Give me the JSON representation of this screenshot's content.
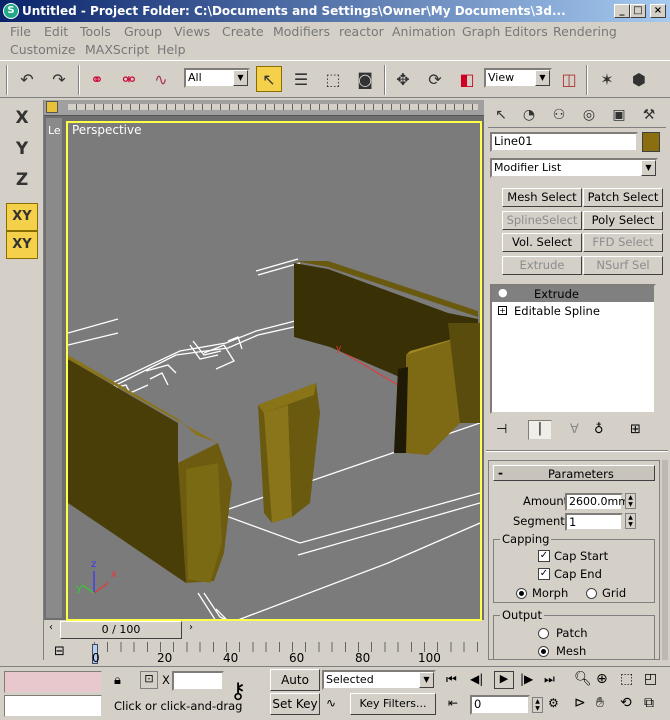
{
  "window": {
    "title": "Untitled     - Project Folder: C:\\Documents and Settings\\Owner\\My Documents\\3d...",
    "app_icon": "3ds-max-logo-icon",
    "controls": [
      "_",
      "□",
      "×"
    ]
  },
  "menubar": {
    "row1": [
      "File",
      "Edit",
      "Tools",
      "Group",
      "Views",
      "Create",
      "Modifiers",
      "reactor",
      "Animation",
      "Graph Editors",
      "Rendering"
    ],
    "row2": [
      "Customize",
      "MAXScript",
      "Help"
    ]
  },
  "toolbar": {
    "selection_filter": "All",
    "reference_coord": "View"
  },
  "axis_constraints": {
    "x": "X",
    "y": "Y",
    "z": "Z",
    "xy": "XY",
    "xy2": "XY"
  },
  "viewport": {
    "label": "Perspective",
    "left_label": "Le",
    "gizmo": {
      "x": "x",
      "y": "y",
      "z": "z"
    }
  },
  "command_panel": {
    "object_name": "Line01",
    "object_color": "#8a6e10",
    "modifier_list": "Modifier List",
    "buttons": [
      {
        "label": "Mesh Select",
        "enabled": true
      },
      {
        "label": "Patch Select",
        "enabled": true
      },
      {
        "label": "SplineSelect",
        "enabled": false
      },
      {
        "label": "Poly Select",
        "enabled": true
      },
      {
        "label": "Vol. Select",
        "enabled": true
      },
      {
        "label": "FFD Select",
        "enabled": false
      },
      {
        "label": "Extrude",
        "enabled": false
      },
      {
        "label": "NSurf Sel",
        "enabled": false
      }
    ],
    "stack": [
      {
        "label": "Extrude",
        "selected": true,
        "icon": "lightbulb-icon"
      },
      {
        "label": "Editable Spline",
        "selected": false,
        "icon": "plus-expand-icon"
      }
    ],
    "parameters": {
      "header": "Parameters",
      "collapse": "-",
      "amount_label": "Amount:",
      "amount_value": "2600.0mm",
      "segments_label": "Segments:",
      "segments_value": "1",
      "capping_label": "Capping",
      "cap_start": {
        "label": "Cap Start",
        "checked": true
      },
      "cap_end": {
        "label": "Cap End",
        "checked": true
      },
      "morph": {
        "label": "Morph",
        "selected": true
      },
      "grid": {
        "label": "Grid",
        "selected": false
      },
      "output_label": "Output",
      "patch": {
        "label": "Patch",
        "selected": false
      },
      "mesh": {
        "label": "Mesh",
        "selected": true
      }
    }
  },
  "timeline": {
    "slider_label": "0 / 100",
    "ticks": [
      "0",
      "20",
      "40",
      "60",
      "80",
      "100"
    ]
  },
  "statusbar": {
    "x_label": "X",
    "prompt": "Click or click-and-drag",
    "auto_key": "Auto Key",
    "set_key": "Set Key",
    "key_mode": "Selected",
    "key_filters": "Key Filters...",
    "frame": "0"
  }
}
